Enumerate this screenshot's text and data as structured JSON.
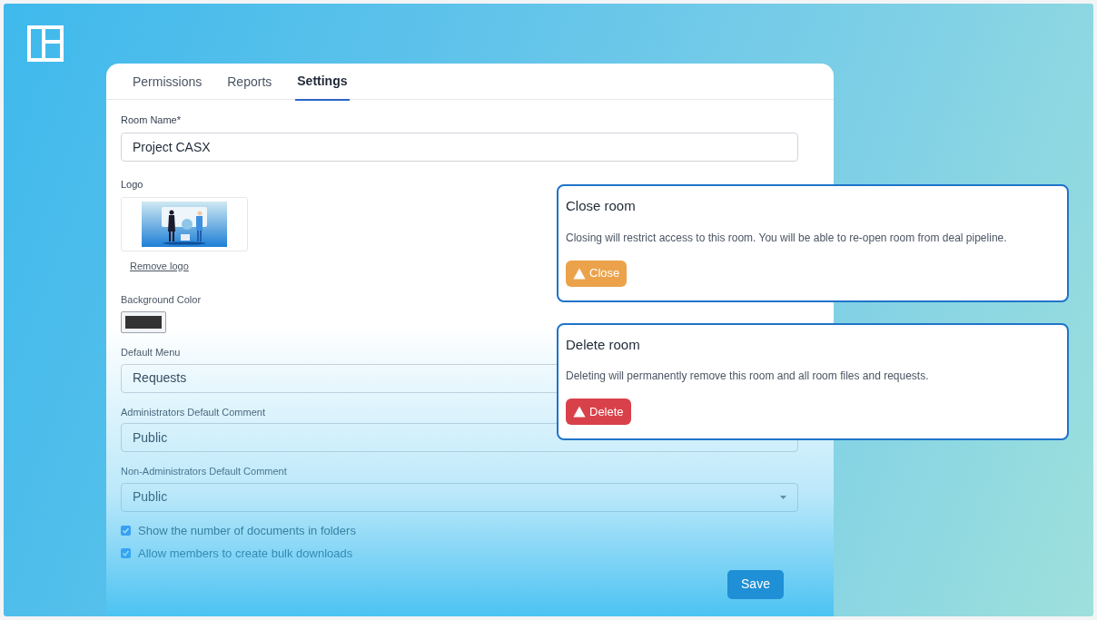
{
  "tabs": [
    {
      "label": "Permissions",
      "selected": false
    },
    {
      "label": "Reports",
      "selected": false
    },
    {
      "label": "Settings",
      "selected": true
    }
  ],
  "form": {
    "room_name": {
      "label": "Room Name*",
      "value": "Project CASX"
    },
    "logo": {
      "label": "Logo",
      "remove_link": "Remove logo"
    },
    "background_color": {
      "label": "Background Color",
      "color": "#333333"
    },
    "selects": [
      {
        "label": "Default Menu",
        "value": "Requests"
      },
      {
        "label": "Administrators Default Comment",
        "value": "Public"
      },
      {
        "label": "Non-Administrators Default Comment",
        "value": "Public"
      }
    ],
    "checkboxes": [
      {
        "label": "Show the number of documents in folders",
        "checked": true
      },
      {
        "label": "Allow members to create bulk downloads",
        "checked": true
      }
    ],
    "save_button": "Save"
  },
  "actions": [
    {
      "kind": "warning",
      "title": "Close room",
      "description": "Closing will restrict access to this room. You will be able to re-open room from deal pipeline.",
      "button": "Close"
    },
    {
      "kind": "danger",
      "title": "Delete room",
      "description": "Deleting will permanently remove this room and all room files and requests.",
      "button": "Delete"
    }
  ]
}
